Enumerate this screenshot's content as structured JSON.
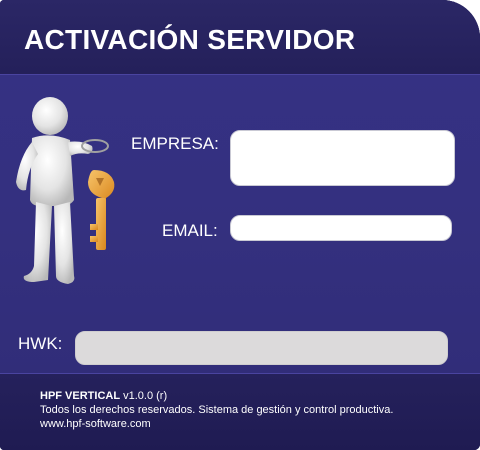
{
  "window": {
    "title": "ACTIVACIÓN SERVIDOR"
  },
  "illustration": {
    "icon": "person-with-key-icon"
  },
  "form": {
    "empresa_label": "EMPRESA:",
    "empresa_value": "",
    "email_label": "EMAIL:",
    "email_value": "",
    "hwk_label": "HWK:",
    "hwk_value": ""
  },
  "footer": {
    "product_name": "HPF VERTICAL",
    "version": " v1.0.0 (r)",
    "rights": "Todos los derechos reservados.  Sistema de gestión y control productiva.",
    "website": "www.hpf-software.com"
  },
  "colors": {
    "panel_bg": "#34307f",
    "title_bar_bg": "#2b2766",
    "footer_bg": "#221e57",
    "field_bg": "#ffffff",
    "hwk_field_bg": "#dcdadb",
    "key_color": "#f0a53a"
  }
}
